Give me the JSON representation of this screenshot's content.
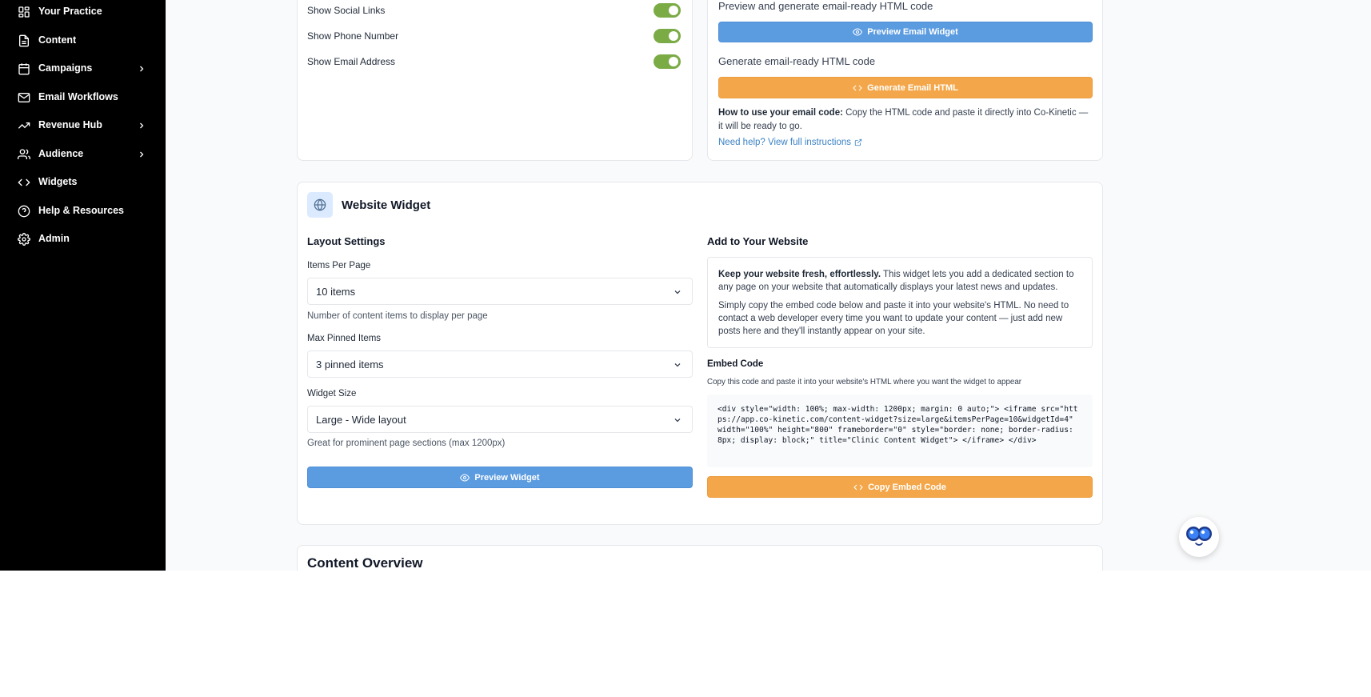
{
  "sidebar": {
    "items": [
      {
        "label": "Your Practice",
        "icon": "grid-icon",
        "has_submenu": false
      },
      {
        "label": "Content",
        "icon": "file-text-icon",
        "has_submenu": false
      },
      {
        "label": "Campaigns",
        "icon": "calendar-icon",
        "has_submenu": true
      },
      {
        "label": "Email Workflows",
        "icon": "mail-icon",
        "has_submenu": false
      },
      {
        "label": "Revenue Hub",
        "icon": "trending-up-icon",
        "has_submenu": true
      },
      {
        "label": "Audience",
        "icon": "users-icon",
        "has_submenu": true
      },
      {
        "label": "Widgets",
        "icon": "code-icon",
        "has_submenu": false
      },
      {
        "label": "Help & Resources",
        "icon": "help-circle-icon",
        "has_submenu": false
      },
      {
        "label": "Admin",
        "icon": "gear-icon",
        "has_submenu": false
      }
    ]
  },
  "email_widget": {
    "toggles": [
      {
        "label": "Show Social Links",
        "on": true
      },
      {
        "label": "Show Phone Number",
        "on": true
      },
      {
        "label": "Show Email Address",
        "on": true
      }
    ],
    "preview_desc": "Preview and generate email-ready HTML code",
    "preview_button": "Preview Email Widget",
    "generate_desc": "Generate email-ready HTML code",
    "generate_button": "Generate Email HTML",
    "howto_bold": "How to use your email code:",
    "howto_text": " Copy the HTML code and paste it directly into Co-Kinetic — it will be ready to go.",
    "help_link": "Need help? View full instructions"
  },
  "website_widget": {
    "title": "Website Widget",
    "layout_heading": "Layout Settings",
    "items_per_page_label": "Items Per Page",
    "items_per_page_value": "10 items",
    "items_per_page_help": "Number of content items to display per page",
    "max_pinned_label": "Max Pinned Items",
    "max_pinned_value": "3 pinned items",
    "widget_size_label": "Widget Size",
    "widget_size_value": "Large - Wide layout",
    "widget_size_help": "Great for prominent page sections (max 1200px)",
    "preview_button": "Preview Widget",
    "add_heading": "Add to Your Website",
    "info_bold": "Keep your website fresh, effortlessly.",
    "info_text1": " This widget lets you add a dedicated section to any page on your website that automatically displays your latest news and updates.",
    "info_text2": "Simply copy the embed code below and paste it into your website's HTML. No need to contact a web developer every time you want to update your content — just add new posts here and they'll instantly appear on your site.",
    "embed_heading": "Embed Code",
    "embed_help": "Copy this code and paste it into your website's HTML where you want the widget to appear",
    "embed_code": "<div style=\"width: 100%; max-width: 1200px; margin: 0 auto;\"> <iframe src=\"https://app.co-kinetic.com/content-widget?size=large&itemsPerPage=10&widgetId=4\" width=\"100%\" height=\"800\" frameborder=\"0\" style=\"border: none; border-radius: 8px; display: block;\" title=\"Clinic Content Widget\"> </iframe> </div>",
    "copy_button": "Copy Embed Code"
  },
  "content_overview": {
    "title": "Content Overview"
  },
  "colors": {
    "sidebar_bg": "#000000",
    "toggle_on": "#7bab45",
    "primary_blue": "#5b9be0",
    "accent_orange": "#f4a74a",
    "link_blue": "#3b82c4"
  }
}
